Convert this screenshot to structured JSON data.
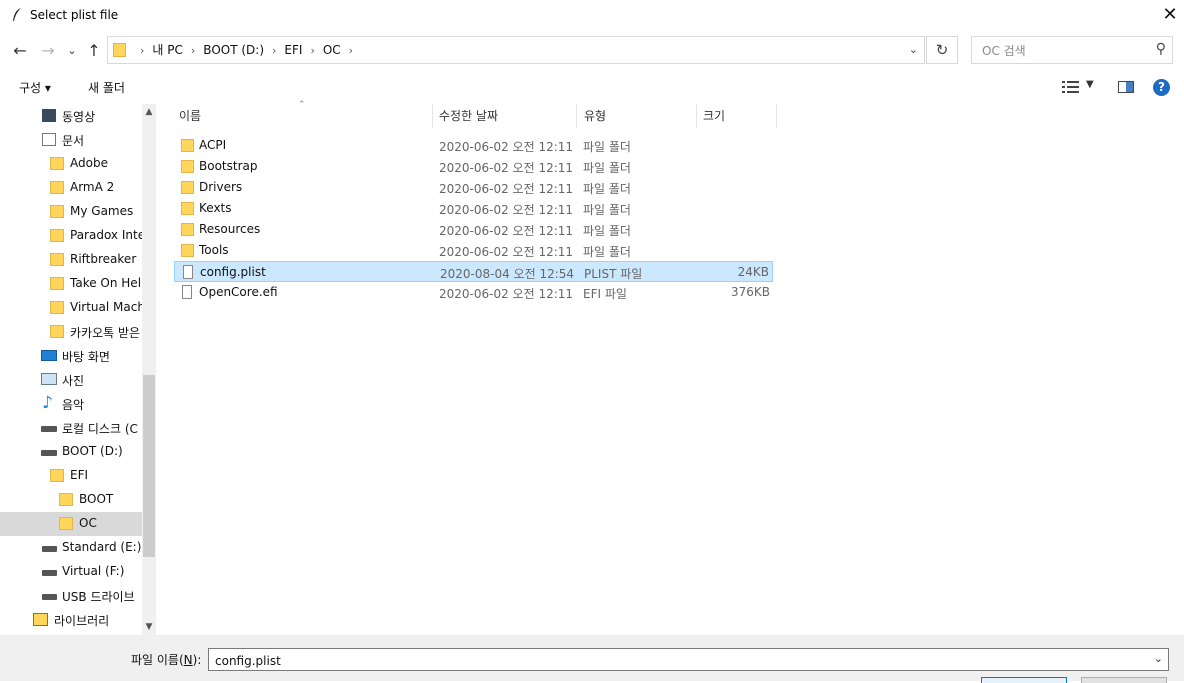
{
  "window": {
    "title": "Select plist file"
  },
  "nav": {
    "back": "←",
    "forward": "→",
    "recent": "⌄",
    "up": "↑",
    "breadcrumb": [
      "내 PC",
      "BOOT (D:)",
      "EFI",
      "OC"
    ],
    "refresh": "↻",
    "search_placeholder": "OC 검색"
  },
  "toolbar": {
    "organize": "구성 ▾",
    "new_folder": "새 폴더"
  },
  "sidebar": {
    "items": [
      {
        "label": "동영상",
        "icon": "video-icon"
      },
      {
        "label": "문서",
        "icon": "document-icon"
      },
      {
        "label": "Adobe",
        "icon": "folder-icon"
      },
      {
        "label": "ArmA 2",
        "icon": "folder-icon"
      },
      {
        "label": "My Games",
        "icon": "folder-icon"
      },
      {
        "label": "Paradox Inter",
        "icon": "folder-icon"
      },
      {
        "label": "Riftbreaker",
        "icon": "folder-icon"
      },
      {
        "label": "Take On Heli",
        "icon": "folder-icon"
      },
      {
        "label": "Virtual Mach",
        "icon": "folder-icon"
      },
      {
        "label": "카카오톡 받은",
        "icon": "folder-icon"
      },
      {
        "label": "바탕 화면",
        "icon": "desktop-icon"
      },
      {
        "label": "사진",
        "icon": "pictures-icon"
      },
      {
        "label": "음악",
        "icon": "music-icon"
      },
      {
        "label": "로컬 디스크 (C",
        "icon": "drive-icon"
      },
      {
        "label": "BOOT (D:)",
        "icon": "drive-icon"
      },
      {
        "label": "EFI",
        "icon": "folder-icon"
      },
      {
        "label": "BOOT",
        "icon": "folder-icon"
      },
      {
        "label": "OC",
        "icon": "folder-icon"
      },
      {
        "label": "Standard (E:)",
        "icon": "drive-icon"
      },
      {
        "label": "Virtual (F:)",
        "icon": "drive-icon"
      },
      {
        "label": "USB 드라이브",
        "icon": "drive-icon"
      },
      {
        "label": "라이브러리",
        "icon": "library-icon"
      }
    ]
  },
  "columns": {
    "name": "이름",
    "date": "수정한 날짜",
    "type": "유형",
    "size": "크기"
  },
  "files": [
    {
      "name": "ACPI",
      "date": "2020-06-02 오전 12:11",
      "type": "파일 폴더",
      "size": ""
    },
    {
      "name": "Bootstrap",
      "date": "2020-06-02 오전 12:11",
      "type": "파일 폴더",
      "size": ""
    },
    {
      "name": "Drivers",
      "date": "2020-06-02 오전 12:11",
      "type": "파일 폴더",
      "size": ""
    },
    {
      "name": "Kexts",
      "date": "2020-06-02 오전 12:11",
      "type": "파일 폴더",
      "size": ""
    },
    {
      "name": "Resources",
      "date": "2020-06-02 오전 12:11",
      "type": "파일 폴더",
      "size": ""
    },
    {
      "name": "Tools",
      "date": "2020-06-02 오전 12:11",
      "type": "파일 폴더",
      "size": ""
    },
    {
      "name": "config.plist",
      "date": "2020-08-04 오전 12:54",
      "type": "PLIST 파일",
      "size": "24KB"
    },
    {
      "name": "OpenCore.efi",
      "date": "2020-06-02 오전 12:11",
      "type": "EFI 파일",
      "size": "376KB"
    }
  ],
  "footer": {
    "filename_label_prefix": "파일 이름(",
    "filename_label_key": "N",
    "filename_label_suffix": "):",
    "filename_value": "config.plist"
  },
  "colors": {
    "selection": "#cce8ff",
    "folder": "#ffd65c",
    "accent": "#0078d7"
  }
}
